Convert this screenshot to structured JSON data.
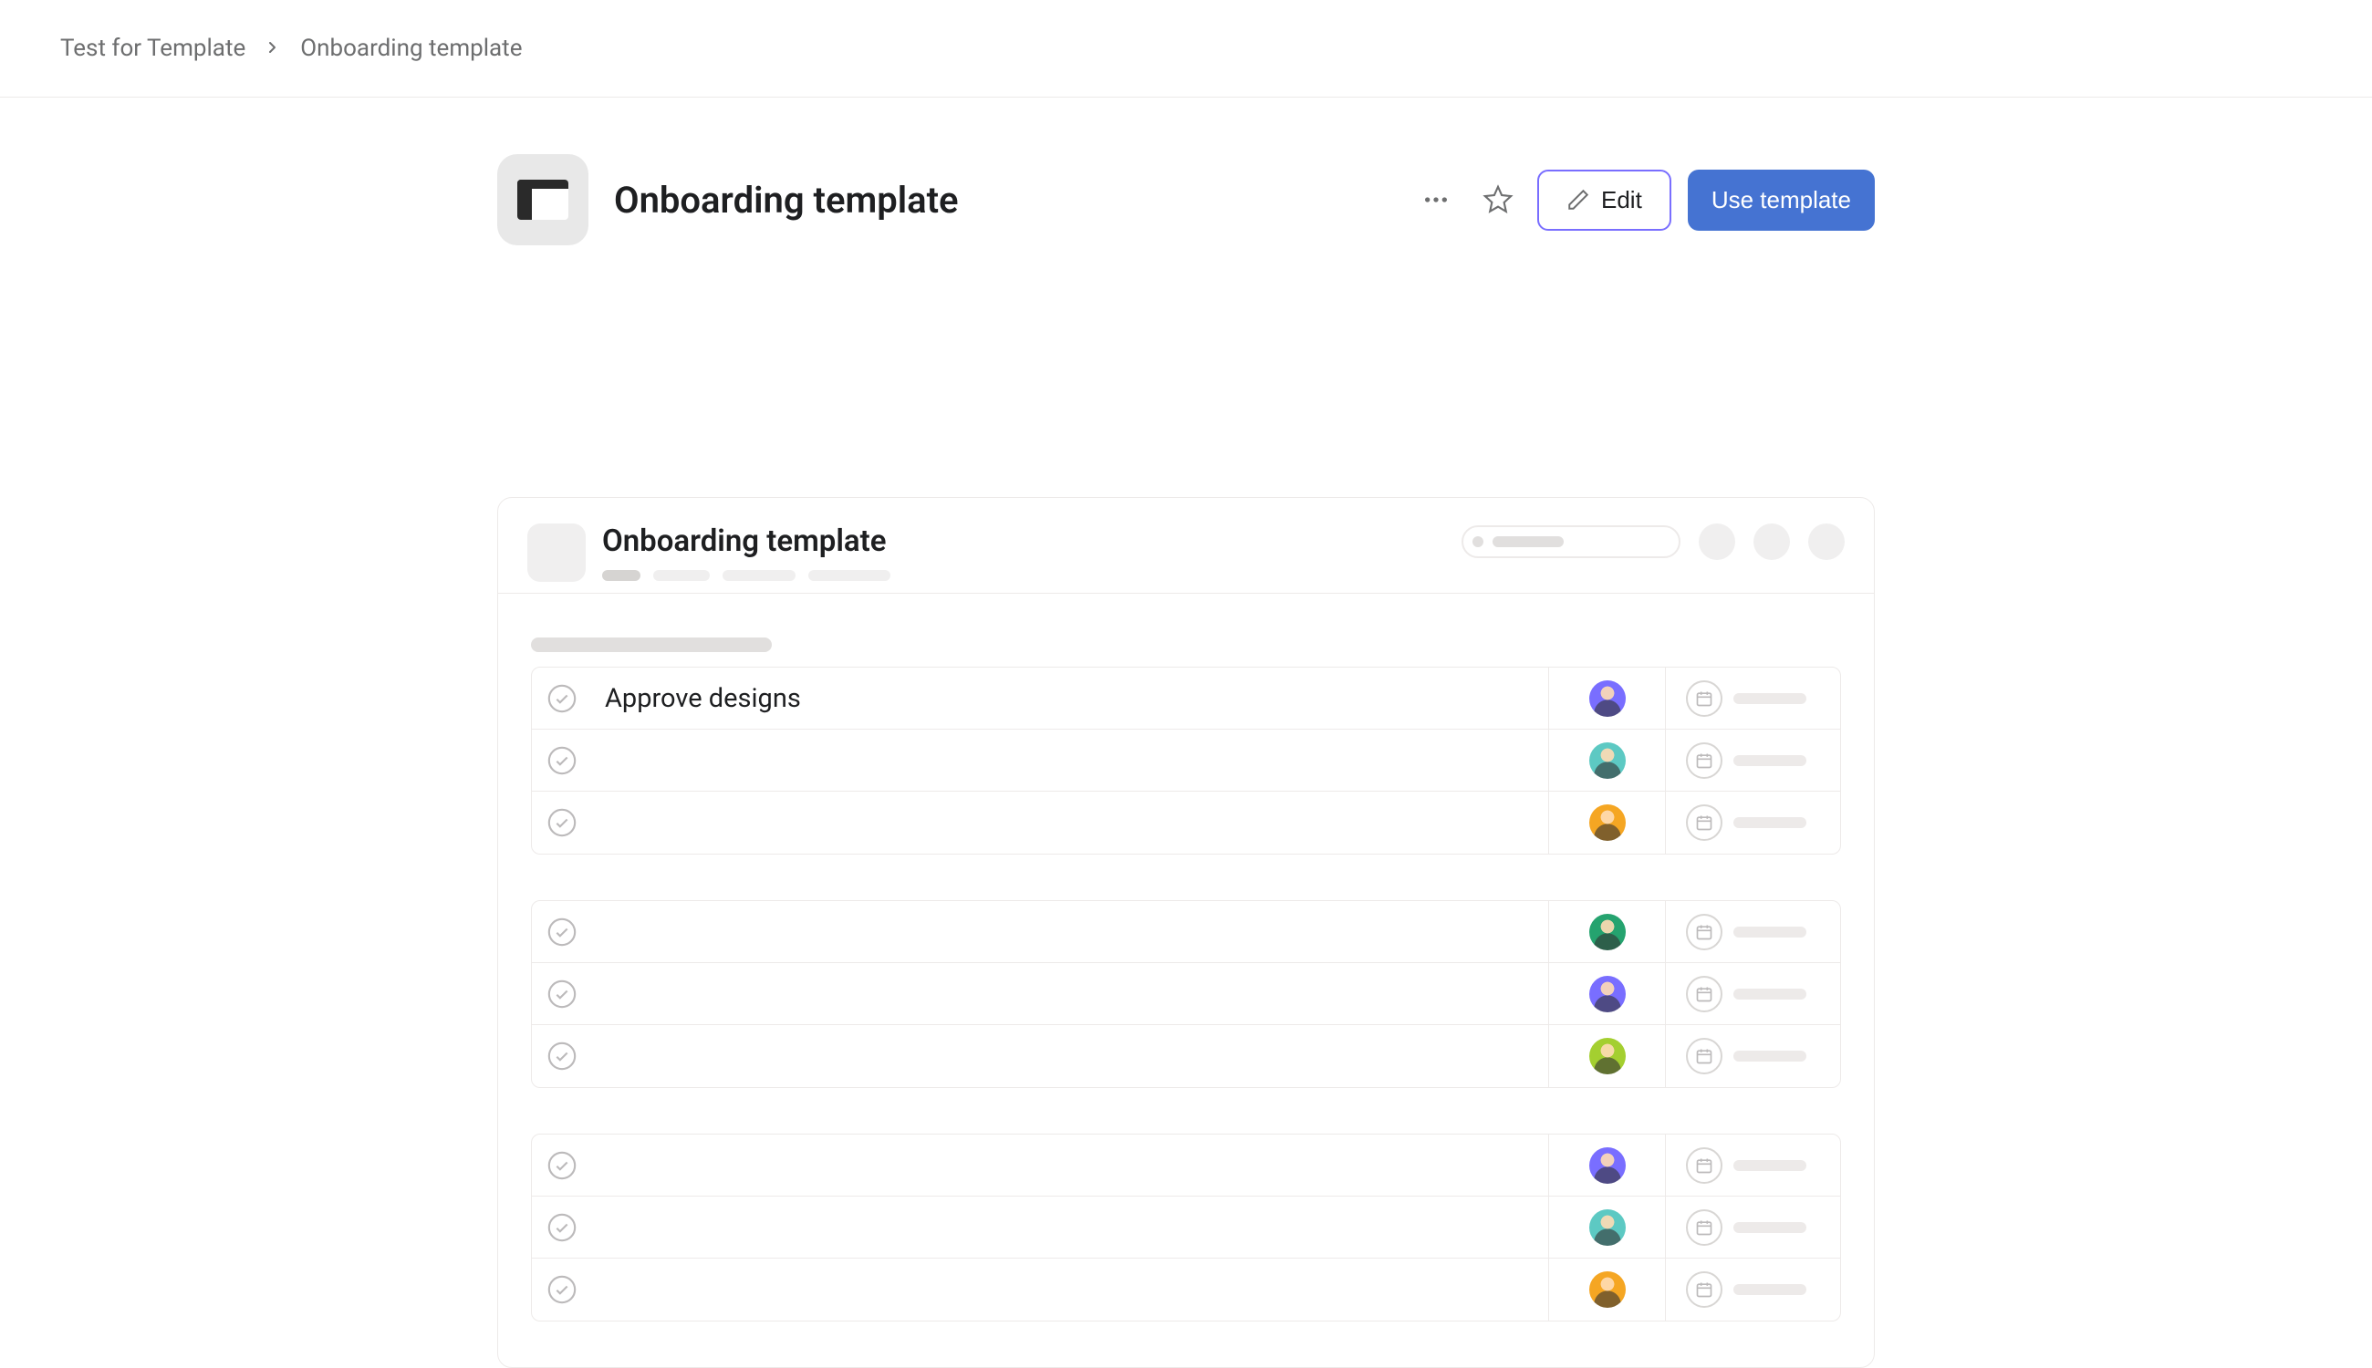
{
  "breadcrumb": {
    "parent": "Test for Template",
    "current": "Onboarding template"
  },
  "header": {
    "title": "Onboarding template",
    "actions": {
      "edit": "Edit",
      "use_template": "Use template"
    }
  },
  "preview": {
    "title": "Onboarding template",
    "sections": [
      {
        "tasks": [
          {
            "name": "Approve designs",
            "avatar_color": "#796eff"
          },
          {
            "name": "",
            "avatar_color": "#5dc9c3"
          },
          {
            "name": "",
            "avatar_color": "#f5a623"
          }
        ]
      },
      {
        "tasks": [
          {
            "name": "",
            "avatar_color": "#25a36f"
          },
          {
            "name": "",
            "avatar_color": "#796eff"
          },
          {
            "name": "",
            "avatar_color": "#a4cf30"
          }
        ]
      },
      {
        "tasks": [
          {
            "name": "",
            "avatar_color": "#796eff"
          },
          {
            "name": "",
            "avatar_color": "#5dc9c3"
          },
          {
            "name": "",
            "avatar_color": "#f5a623"
          }
        ]
      }
    ]
  }
}
